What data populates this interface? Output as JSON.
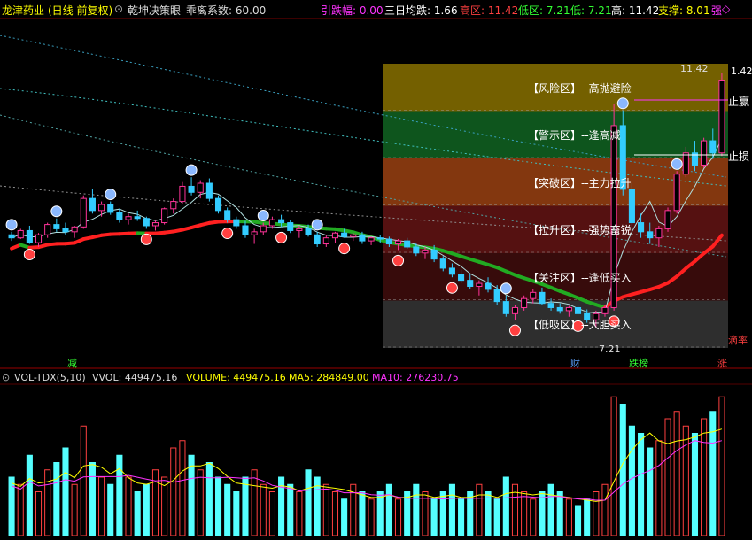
{
  "header": {
    "title": "龙津药业",
    "period": "(日线 前复权)",
    "indicator_name": "乾坤决策眼",
    "deviation": "乖离系数: 60.00",
    "yindie": "引跌幅: 0.00",
    "sanri": "三日均跌: 1.66",
    "high_zone": "高区: 11.42",
    "low_zone": "低区: 7.21",
    "low": "低: 7.21",
    "high": "高: 11.42",
    "support": "支撑: 8.01",
    "strong": "强",
    "colors": {
      "red": "#ff4040",
      "green": "#33ff33",
      "white": "#ffffff",
      "yellow": "#ffff00",
      "magenta": "#ff33ff"
    }
  },
  "zones": [
    {
      "label": "【风险区】--高抛避险",
      "color": "#7a6500"
    },
    {
      "label": "【警示区】--逢高减",
      "color": "#0f5a1f"
    },
    {
      "label": "【突破区】--主力拉升",
      "color": "#8a3a10"
    },
    {
      "label": "【拉升区】--强势畜锐",
      "color": "#5a1212"
    },
    {
      "label": "【关注区】--逢低买入",
      "color": "#3a0c0c"
    },
    {
      "label": "【低吸区】--大胆买入",
      "color": "#303030"
    }
  ],
  "annotations": {
    "max_price": "11.42",
    "max_price_right": "1.42",
    "min_price": "7.21",
    "stop_profit": "止赢",
    "stop_loss": "止损",
    "rate": "滴率",
    "marks": [
      "减",
      "财",
      "跌榜",
      "涨"
    ]
  },
  "volume_header": {
    "name": "VOL-TDX(5,10)",
    "vvol": "VVOL: 449475.16",
    "volume": "VOLUME: 449475.16",
    "ma5": "MA5: 284849.00",
    "ma10": "MA10: 276230.75"
  },
  "chart_data": {
    "type": "candlestick",
    "price_range": [
      7.21,
      11.42
    ],
    "candles": [
      [
        8.75,
        8.8,
        8.65,
        8.7
      ],
      [
        8.7,
        8.85,
        8.68,
        8.82
      ],
      [
        8.82,
        8.9,
        8.6,
        8.62
      ],
      [
        8.62,
        8.78,
        8.55,
        8.75
      ],
      [
        8.75,
        8.95,
        8.7,
        8.92
      ],
      [
        8.92,
        9.02,
        8.8,
        8.85
      ],
      [
        8.85,
        8.95,
        8.75,
        8.8
      ],
      [
        8.8,
        8.9,
        8.7,
        8.88
      ],
      [
        8.88,
        9.4,
        8.85,
        9.35
      ],
      [
        9.35,
        9.5,
        9.1,
        9.15
      ],
      [
        9.15,
        9.3,
        9.05,
        9.25
      ],
      [
        9.25,
        9.3,
        9.08,
        9.12
      ],
      [
        9.12,
        9.18,
        8.95,
        9.0
      ],
      [
        9.0,
        9.1,
        8.92,
        9.05
      ],
      [
        9.05,
        9.15,
        8.98,
        9.02
      ],
      [
        9.02,
        9.05,
        8.85,
        8.9
      ],
      [
        8.9,
        9.0,
        8.82,
        8.95
      ],
      [
        8.95,
        9.2,
        8.92,
        9.18
      ],
      [
        9.18,
        9.35,
        9.1,
        9.3
      ],
      [
        9.3,
        9.62,
        9.25,
        9.55
      ],
      [
        9.55,
        9.7,
        9.4,
        9.45
      ],
      [
        9.45,
        9.65,
        9.35,
        9.6
      ],
      [
        9.6,
        9.68,
        9.3,
        9.35
      ],
      [
        9.35,
        9.4,
        9.1,
        9.15
      ],
      [
        9.15,
        9.2,
        8.95,
        9.0
      ],
      [
        9.0,
        9.05,
        8.85,
        8.9
      ],
      [
        8.9,
        8.98,
        8.7,
        8.75
      ],
      [
        8.75,
        8.85,
        8.6,
        8.8
      ],
      [
        8.8,
        8.95,
        8.75,
        8.9
      ],
      [
        8.9,
        9.05,
        8.85,
        9.0
      ],
      [
        9.0,
        9.08,
        8.88,
        8.95
      ],
      [
        8.95,
        9.0,
        8.78,
        8.82
      ],
      [
        8.82,
        8.9,
        8.7,
        8.85
      ],
      [
        8.85,
        8.92,
        8.72,
        8.75
      ],
      [
        8.75,
        8.8,
        8.55,
        8.6
      ],
      [
        8.6,
        8.75,
        8.55,
        8.7
      ],
      [
        8.7,
        8.8,
        8.62,
        8.78
      ],
      [
        8.78,
        8.85,
        8.7,
        8.72
      ],
      [
        8.72,
        8.78,
        8.65,
        8.75
      ],
      [
        8.75,
        8.8,
        8.6,
        8.65
      ],
      [
        8.65,
        8.72,
        8.58,
        8.7
      ],
      [
        8.7,
        8.75,
        8.62,
        8.68
      ],
      [
        8.68,
        8.72,
        8.55,
        8.6
      ],
      [
        8.6,
        8.68,
        8.5,
        8.65
      ],
      [
        8.65,
        8.7,
        8.52,
        8.55
      ],
      [
        8.55,
        8.62,
        8.4,
        8.45
      ],
      [
        8.45,
        8.55,
        8.35,
        8.5
      ],
      [
        8.5,
        8.58,
        8.3,
        8.35
      ],
      [
        8.35,
        8.4,
        8.15,
        8.2
      ],
      [
        8.2,
        8.28,
        8.05,
        8.1
      ],
      [
        8.1,
        8.18,
        7.95,
        8.0
      ],
      [
        8.0,
        8.1,
        7.85,
        7.9
      ],
      [
        7.9,
        8.0,
        7.75,
        7.95
      ],
      [
        7.95,
        8.05,
        7.8,
        7.85
      ],
      [
        7.85,
        7.92,
        7.6,
        7.65
      ],
      [
        7.65,
        7.75,
        7.4,
        7.45
      ],
      [
        7.45,
        7.6,
        7.35,
        7.55
      ],
      [
        7.55,
        7.75,
        7.5,
        7.7
      ],
      [
        7.7,
        7.85,
        7.62,
        7.8
      ],
      [
        7.8,
        7.88,
        7.6,
        7.62
      ],
      [
        7.62,
        7.7,
        7.5,
        7.55
      ],
      [
        7.55,
        7.62,
        7.45,
        7.5
      ],
      [
        7.5,
        7.58,
        7.4,
        7.55
      ],
      [
        7.55,
        7.6,
        7.42,
        7.45
      ],
      [
        7.45,
        7.52,
        7.3,
        7.35
      ],
      [
        7.35,
        7.5,
        7.21,
        7.45
      ],
      [
        7.45,
        7.6,
        7.4,
        7.55
      ],
      [
        7.55,
        10.9,
        7.5,
        10.55
      ],
      [
        10.55,
        10.8,
        9.4,
        9.5
      ],
      [
        9.5,
        9.6,
        8.8,
        8.95
      ],
      [
        8.95,
        9.1,
        8.7,
        8.8
      ],
      [
        8.8,
        8.95,
        8.6,
        8.7
      ],
      [
        8.7,
        8.9,
        8.55,
        8.85
      ],
      [
        8.85,
        9.2,
        8.8,
        9.15
      ],
      [
        9.15,
        9.8,
        9.1,
        9.75
      ],
      [
        9.75,
        10.2,
        9.7,
        10.1
      ],
      [
        10.1,
        10.3,
        9.8,
        9.9
      ],
      [
        9.9,
        10.35,
        9.85,
        10.3
      ],
      [
        10.3,
        10.5,
        10.0,
        10.1
      ],
      [
        10.1,
        11.42,
        10.05,
        11.3
      ]
    ],
    "volume": [
      0.4,
      0.35,
      0.55,
      0.3,
      0.45,
      0.5,
      0.6,
      0.35,
      0.75,
      0.5,
      0.4,
      0.35,
      0.55,
      0.4,
      0.3,
      0.35,
      0.45,
      0.4,
      0.6,
      0.65,
      0.55,
      0.45,
      0.5,
      0.4,
      0.35,
      0.3,
      0.4,
      0.45,
      0.35,
      0.3,
      0.4,
      0.35,
      0.3,
      0.45,
      0.4,
      0.35,
      0.3,
      0.25,
      0.35,
      0.3,
      0.25,
      0.3,
      0.35,
      0.25,
      0.3,
      0.35,
      0.3,
      0.25,
      0.3,
      0.35,
      0.25,
      0.3,
      0.35,
      0.3,
      0.25,
      0.4,
      0.35,
      0.3,
      0.25,
      0.3,
      0.35,
      0.3,
      0.25,
      0.2,
      0.25,
      0.3,
      0.35,
      0.95,
      0.9,
      0.75,
      0.7,
      0.6,
      0.65,
      0.8,
      0.85,
      0.75,
      0.7,
      0.8,
      0.85,
      0.95
    ]
  }
}
